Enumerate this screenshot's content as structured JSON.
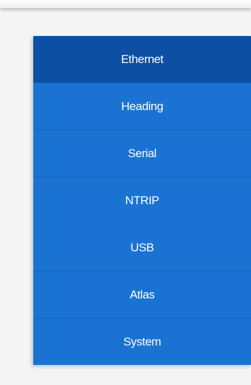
{
  "colors": {
    "menu_background": "#1a73d2",
    "menu_active_background": "#0d4fa3",
    "menu_divider": "#1462b5",
    "menu_text": "#ffffff",
    "page_background": "#f4f4f4"
  },
  "nav": {
    "active_item": "Ethernet",
    "items": [
      {
        "label": "Ethernet"
      },
      {
        "label": "Heading"
      },
      {
        "label": "Serial"
      },
      {
        "label": "NTRIP"
      },
      {
        "label": "USB"
      },
      {
        "label": "Atlas"
      },
      {
        "label": "System"
      }
    ]
  }
}
